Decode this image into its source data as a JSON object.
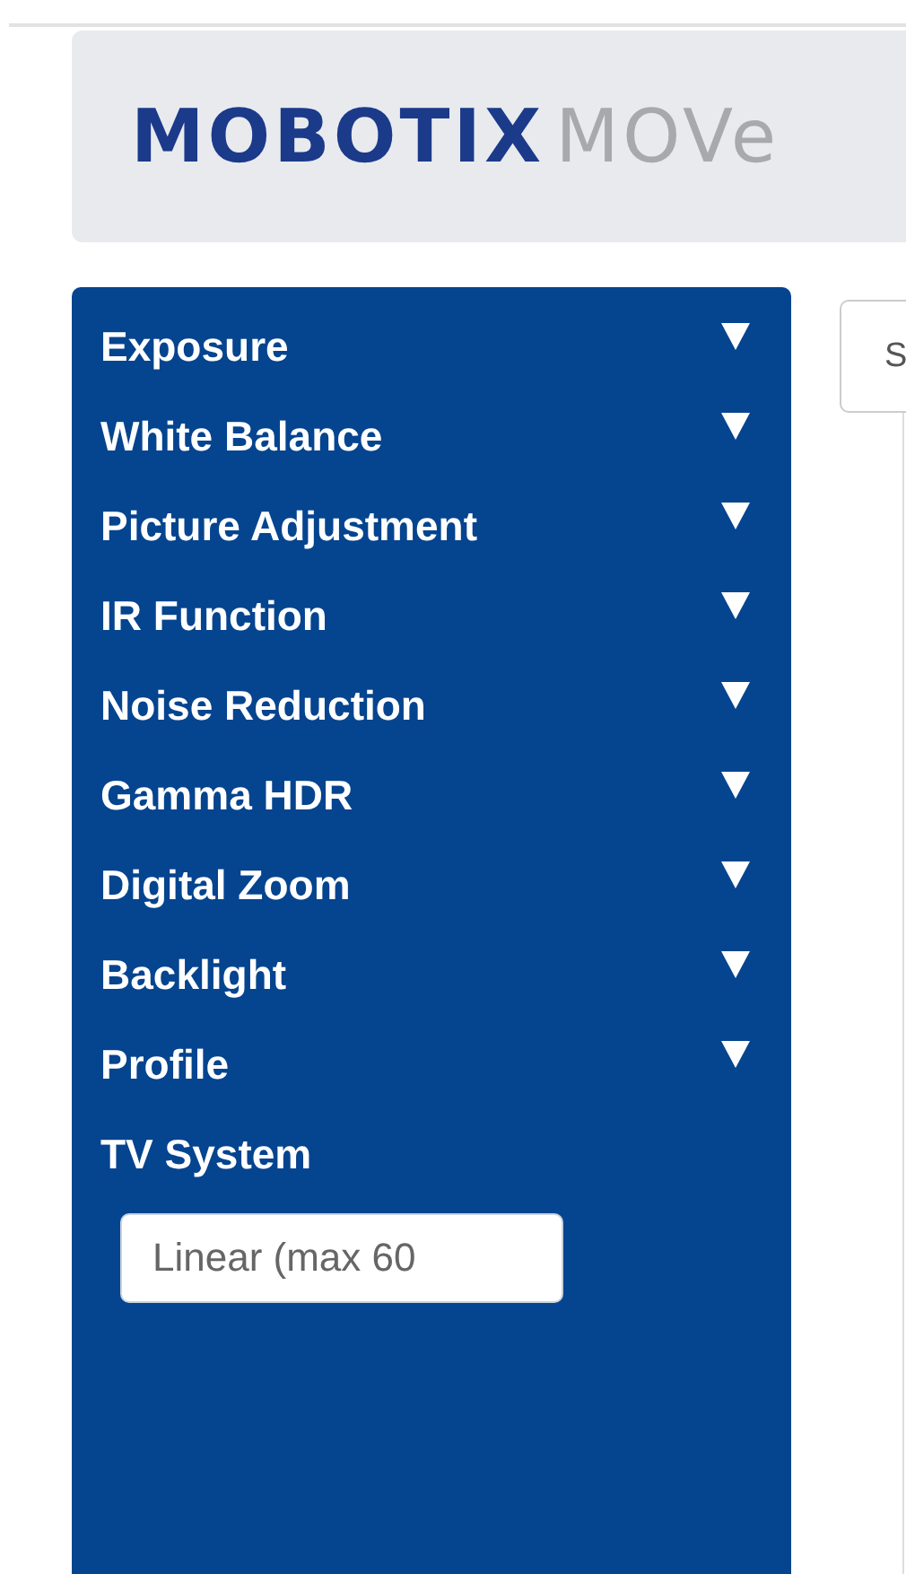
{
  "header": {
    "logo_primary": "MOBOTIX",
    "logo_secondary": "MOVe"
  },
  "sidebar": {
    "items": [
      {
        "label": "Exposure",
        "kind": "section",
        "expanded": false
      },
      {
        "label": "White Balance",
        "kind": "section",
        "expanded": false
      },
      {
        "label": "Picture Adjustment",
        "kind": "section",
        "expanded": false
      },
      {
        "label": "IR Function",
        "kind": "section",
        "expanded": false
      },
      {
        "label": "Noise Reduction",
        "kind": "section",
        "expanded": false
      },
      {
        "label": "Gamma HDR",
        "kind": "section",
        "expanded": false
      },
      {
        "label": "Digital Zoom",
        "kind": "section",
        "expanded": false
      },
      {
        "label": "Backlight",
        "kind": "section",
        "expanded": false
      },
      {
        "label": "Profile",
        "kind": "section",
        "expanded": false
      },
      {
        "label": "TV System",
        "kind": "label"
      }
    ],
    "tv_system_select": {
      "value": "Linear (max 60"
    }
  },
  "main": {
    "field_text": "S"
  }
}
